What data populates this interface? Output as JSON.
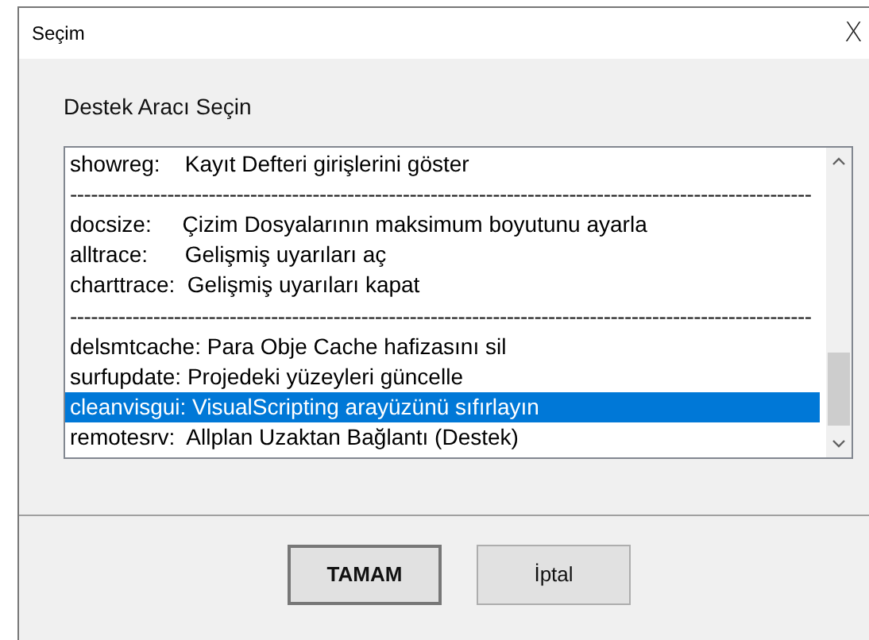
{
  "window": {
    "title": "Seçim",
    "close": "X"
  },
  "prompt": "Destek Aracı Seçin",
  "list": {
    "items": [
      {
        "kind": "entry",
        "text": "showreg:    Kayıt Defteri girişlerini göster",
        "selected": false
      },
      {
        "kind": "separator",
        "text": "-----------------------------------------------------------------------------------------------------------"
      },
      {
        "kind": "entry",
        "text": "docsize:     Çizim Dosyalarının maksimum boyutunu ayarla",
        "selected": false
      },
      {
        "kind": "entry",
        "text": "alltrace:      Gelişmiş uyarıları aç",
        "selected": false
      },
      {
        "kind": "entry",
        "text": "charttrace:  Gelişmiş uyarıları kapat",
        "selected": false
      },
      {
        "kind": "separator",
        "text": "-----------------------------------------------------------------------------------------------------------"
      },
      {
        "kind": "entry",
        "text": "delsmtcache: Para Obje Cache hafizasını sil",
        "selected": false
      },
      {
        "kind": "entry",
        "text": "surfupdate: Projedeki yüzeyleri güncelle",
        "selected": false
      },
      {
        "kind": "entry",
        "text": "cleanvisgui: VisualScripting arayüzünü sıfırlayın",
        "selected": true
      },
      {
        "kind": "entry",
        "text": "remotesrv:  Allplan Uzaktan Bağlantı (Destek)",
        "selected": false
      }
    ]
  },
  "buttons": [
    {
      "label": "TAMAM",
      "default": true
    },
    {
      "label": "İptal",
      "default": false
    }
  ]
}
